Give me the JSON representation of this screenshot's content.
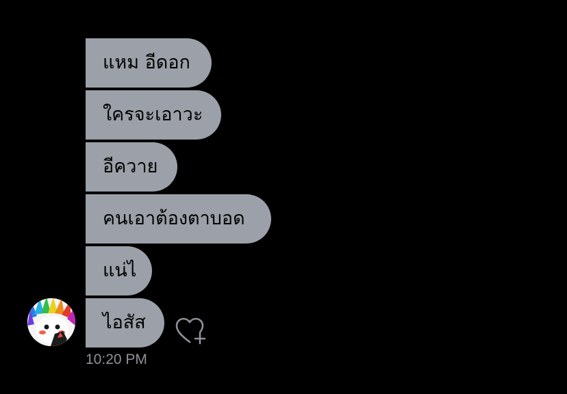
{
  "conversation": {
    "messages": [
      {
        "text": "แหม อีดอก"
      },
      {
        "text": "ใครจะเอาวะ"
      },
      {
        "text": "อีควาย"
      },
      {
        "text": "คนเอาต้องตาบอด"
      },
      {
        "text": "แน่ไ"
      },
      {
        "text": "ไอสัส"
      }
    ],
    "timestamp": "10:20 PM",
    "sender_avatar_icon": "avatar-rainbow-hair",
    "reaction_icon": "heart-plus-icon",
    "colors": {
      "background": "#000000",
      "bubble": "#9ba0a9",
      "bubble_text": "#000000",
      "timestamp": "#8e9198",
      "icon_stroke": "#8e9198"
    }
  }
}
